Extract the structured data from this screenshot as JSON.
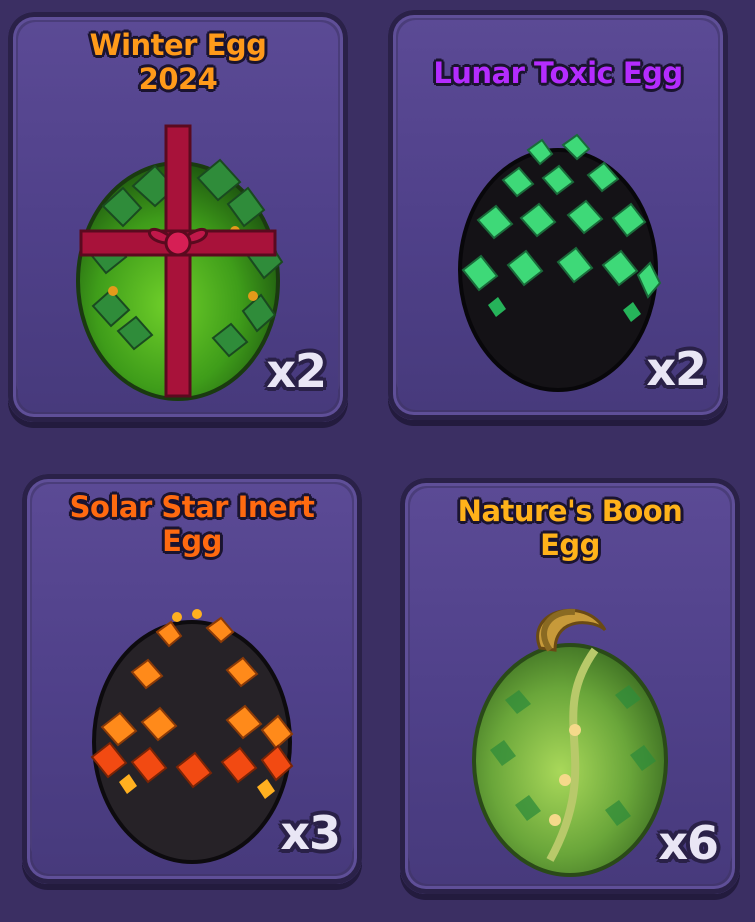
{
  "inventory": {
    "items": [
      {
        "name": "Winter Egg\n2024",
        "name_color": "#ff9a1a",
        "count": "x2",
        "icon": "winter-egg-icon"
      },
      {
        "name": "Lunar Toxic Egg",
        "name_color": "#b42cff",
        "count": "x2",
        "icon": "lunar-toxic-egg-icon"
      },
      {
        "name": "Solar Star Inert\nEgg",
        "name_color": "#ff6a10",
        "count": "x3",
        "icon": "solar-star-inert-egg-icon"
      },
      {
        "name": "Nature's Boon\nEgg",
        "name_color": "#ffb21a",
        "count": "x6",
        "icon": "natures-boon-egg-icon"
      }
    ]
  }
}
